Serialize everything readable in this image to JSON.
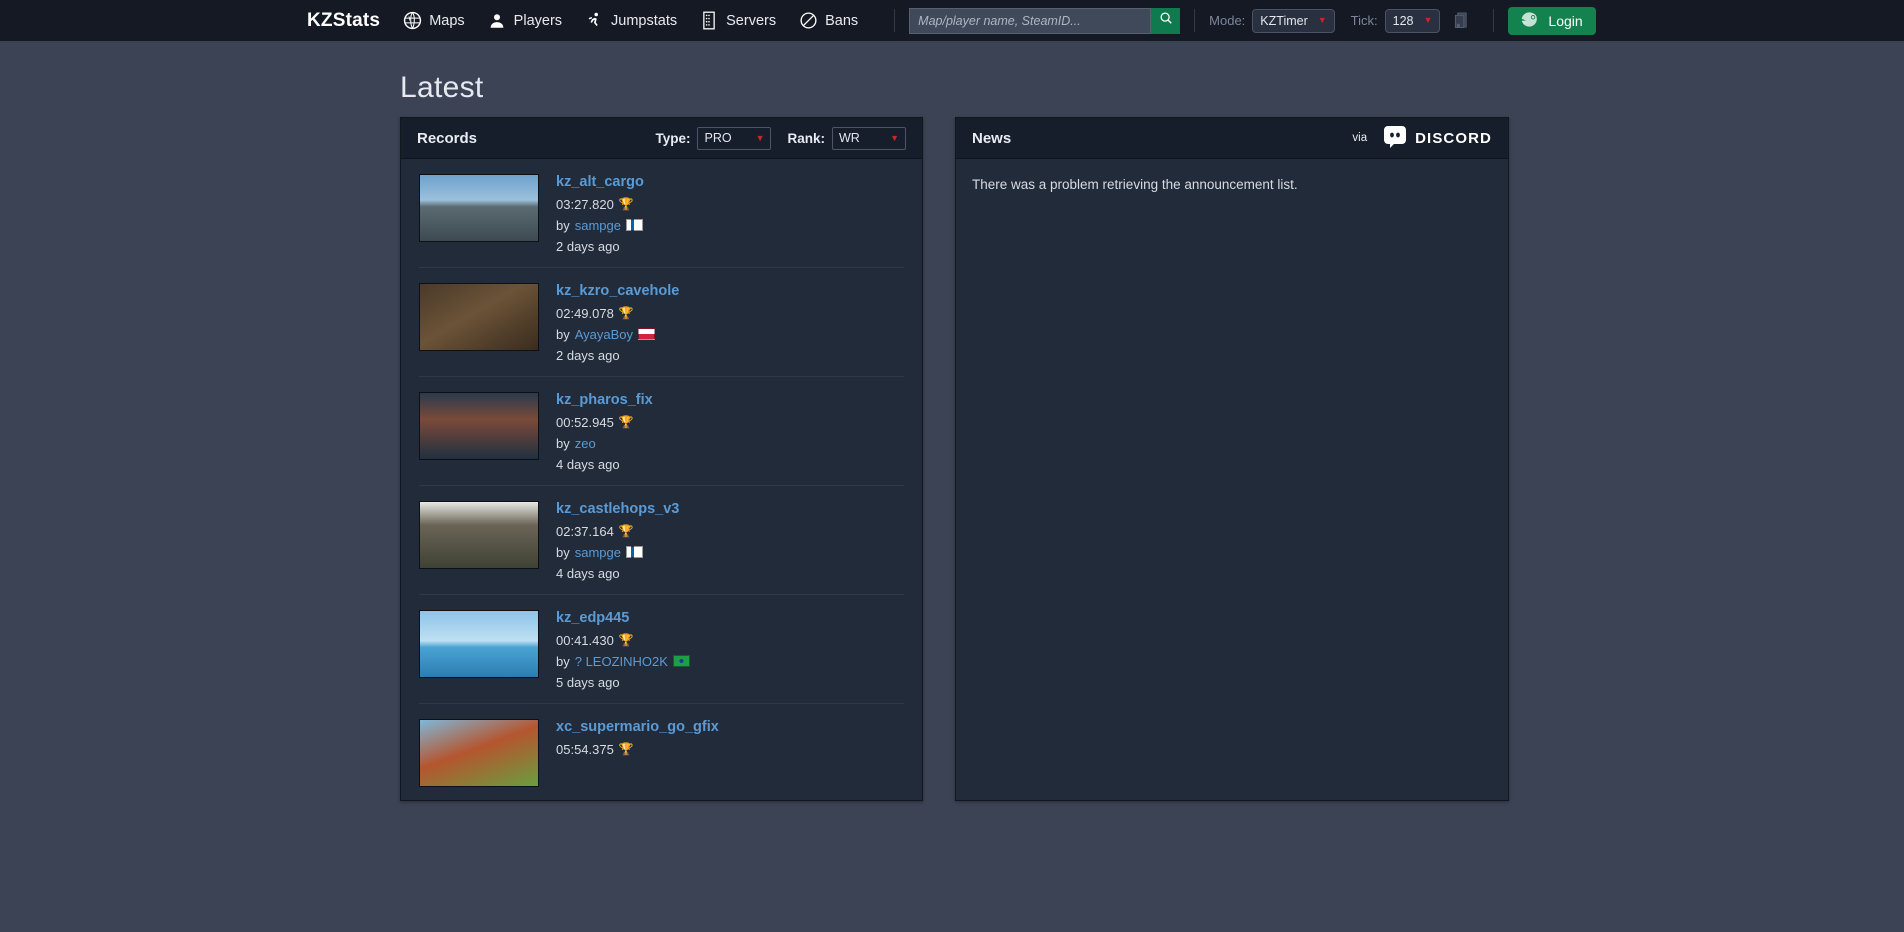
{
  "navbar": {
    "brand": "KZStats",
    "links": [
      {
        "label": "Maps",
        "icon": "globe-icon"
      },
      {
        "label": "Players",
        "icon": "person-icon"
      },
      {
        "label": "Jumpstats",
        "icon": "runner-icon"
      },
      {
        "label": "Servers",
        "icon": "server-icon"
      },
      {
        "label": "Bans",
        "icon": "ban-icon"
      }
    ],
    "search": {
      "placeholder": "Map/player name, SteamID...",
      "value": "",
      "icon": "search-icon"
    },
    "mode": {
      "label": "Mode:",
      "value": "KZTimer"
    },
    "tick": {
      "label": "Tick:",
      "value": "128"
    },
    "server_icon": "server-stack-icon",
    "login": {
      "label": "Login",
      "icon": "steam-icon"
    }
  },
  "page": {
    "title": "Latest"
  },
  "records_panel": {
    "title": "Records",
    "type_filter": {
      "label": "Type:",
      "value": "PRO"
    },
    "rank_filter": {
      "label": "Rank:",
      "value": "WR"
    },
    "rows": [
      {
        "map": "kz_alt_cargo",
        "time": "03:27.820",
        "medal": "trophy-icon",
        "by_prefix": "by",
        "player": "sampge",
        "flag": "fi",
        "ago": "2 days ago"
      },
      {
        "map": "kz_kzro_cavehole",
        "time": "02:49.078",
        "medal": "trophy-icon",
        "by_prefix": "by",
        "player": "AyayaBoy",
        "flag": "pl",
        "ago": "2 days ago"
      },
      {
        "map": "kz_pharos_fix",
        "time": "00:52.945",
        "medal": "trophy-icon",
        "by_prefix": "by",
        "player": "zeo",
        "flag": "",
        "ago": "4 days ago"
      },
      {
        "map": "kz_castlehops_v3",
        "time": "02:37.164",
        "medal": "trophy-icon",
        "by_prefix": "by",
        "player": "sampge",
        "flag": "fi",
        "ago": "4 days ago"
      },
      {
        "map": "kz_edp445",
        "time": "00:41.430",
        "medal": "trophy-icon",
        "by_prefix": "by",
        "player": "? LEOZINHO2K",
        "flag": "br",
        "ago": "5 days ago"
      },
      {
        "map": "xc_supermario_go_gfix",
        "time": "05:54.375",
        "medal": "trophy-icon",
        "by_prefix": "by",
        "player": "",
        "flag": "",
        "ago": ""
      }
    ]
  },
  "news_panel": {
    "title": "News",
    "via_label": "via",
    "source": "DISCORD",
    "message": "There was a problem retrieving the announcement list."
  }
}
